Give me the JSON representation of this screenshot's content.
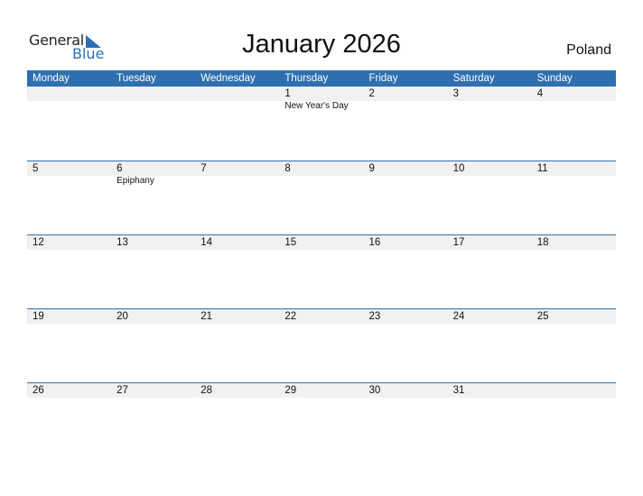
{
  "brand": {
    "general": "General",
    "blue": "Blue"
  },
  "title": "January 2026",
  "country": "Poland",
  "colors": {
    "accent": "#2e6fb0",
    "day_bar": "#f1f1f1"
  },
  "weekdays": [
    "Monday",
    "Tuesday",
    "Wednesday",
    "Thursday",
    "Friday",
    "Saturday",
    "Sunday"
  ],
  "weeks": [
    {
      "days": [
        "",
        "",
        "",
        "1",
        "2",
        "3",
        "4"
      ],
      "events": [
        "",
        "",
        "",
        "New Year's Day",
        "",
        "",
        ""
      ]
    },
    {
      "days": [
        "5",
        "6",
        "7",
        "8",
        "9",
        "10",
        "11"
      ],
      "events": [
        "",
        "Epiphany",
        "",
        "",
        "",
        "",
        ""
      ]
    },
    {
      "days": [
        "12",
        "13",
        "14",
        "15",
        "16",
        "17",
        "18"
      ],
      "events": [
        "",
        "",
        "",
        "",
        "",
        "",
        ""
      ]
    },
    {
      "days": [
        "19",
        "20",
        "21",
        "22",
        "23",
        "24",
        "25"
      ],
      "events": [
        "",
        "",
        "",
        "",
        "",
        "",
        ""
      ]
    },
    {
      "days": [
        "26",
        "27",
        "28",
        "29",
        "30",
        "31",
        ""
      ],
      "events": [
        "",
        "",
        "",
        "",
        "",
        "",
        ""
      ]
    }
  ]
}
